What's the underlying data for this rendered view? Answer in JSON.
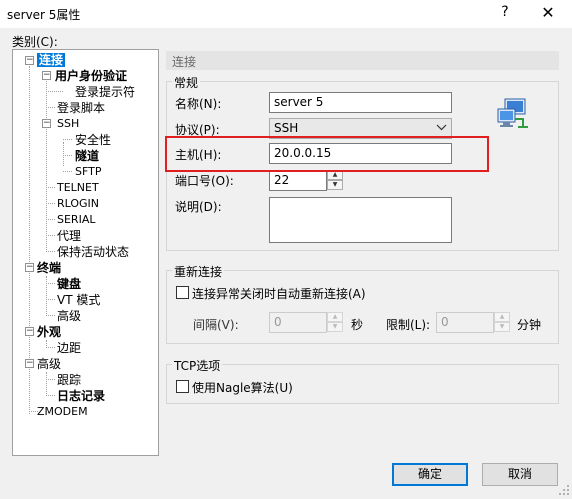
{
  "window": {
    "title": "server 5属性",
    "help_glyph": "?",
    "close_glyph": "✕"
  },
  "category_label": "类别(C):",
  "tree": [
    {
      "label": "连接"
    },
    {
      "label": "用户身份验证"
    },
    {
      "label": "登录提示符"
    },
    {
      "label": "登录脚本"
    },
    {
      "label": "SSH"
    },
    {
      "label": "安全性"
    },
    {
      "label": "隧道"
    },
    {
      "label": "SFTP"
    },
    {
      "label": "TELNET"
    },
    {
      "label": "RLOGIN"
    },
    {
      "label": "SERIAL"
    },
    {
      "label": "代理"
    },
    {
      "label": "保持活动状态"
    },
    {
      "label": "终端"
    },
    {
      "label": "键盘"
    },
    {
      "label": "VT 模式"
    },
    {
      "label": "高级"
    },
    {
      "label": "外观"
    },
    {
      "label": "边距"
    },
    {
      "label": "高级"
    },
    {
      "label": "跟踪"
    },
    {
      "label": "日志记录"
    },
    {
      "label": "ZMODEM"
    }
  ],
  "section_title": "连接",
  "general": {
    "title": "常规",
    "name_label": "名称(N):",
    "name_value": "server 5",
    "protocol_label": "协议(P):",
    "protocol_value": "SSH",
    "host_label": "主机(H):",
    "host_value": "20.0.0.15",
    "port_label": "端口号(O):",
    "port_value": "22",
    "desc_label": "说明(D):",
    "desc_value": ""
  },
  "reconnect": {
    "title": "重新连接",
    "checkbox_label": "连接异常关闭时自动重新连接(A)",
    "interval_label": "间隔(V):",
    "interval_value": "0",
    "interval_unit": "秒",
    "limit_label": "限制(L):",
    "limit_value": "0",
    "limit_unit": "分钟"
  },
  "tcp": {
    "title": "TCP选项",
    "nagle_label": "使用Nagle算法(U)"
  },
  "buttons": {
    "ok": "确定",
    "cancel": "取消"
  },
  "icons": {
    "computer": "network-computer-icon"
  },
  "colors": {
    "highlight_box": "#e02020",
    "selection": "#0078d7"
  }
}
